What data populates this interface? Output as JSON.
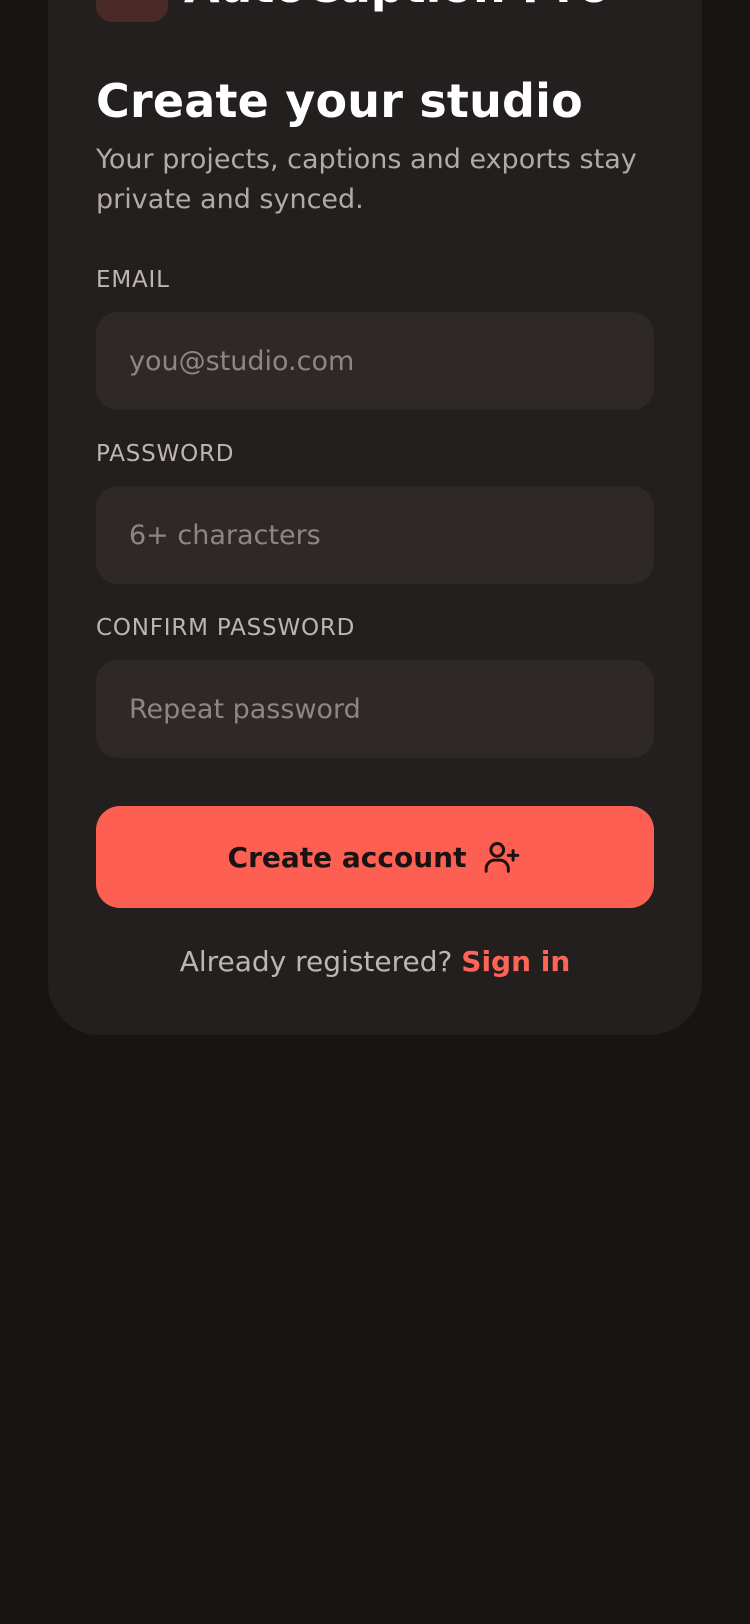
{
  "brand": {
    "name": "AutoCaption Pro"
  },
  "heading": {
    "title": "Create your studio",
    "subtitle": "Your projects, captions and exports stay private and synced."
  },
  "form": {
    "email": {
      "label": "EMAIL",
      "placeholder": "you@studio.com",
      "value": ""
    },
    "password": {
      "label": "PASSWORD",
      "placeholder": "6+ characters",
      "value": ""
    },
    "confirm_password": {
      "label": "CONFIRM PASSWORD",
      "placeholder": "Repeat password",
      "value": ""
    },
    "submit": {
      "label": "Create account",
      "icon": "user-plus-icon"
    }
  },
  "footer": {
    "prompt": "Already registered?",
    "link_label": "Sign in"
  },
  "colors": {
    "background": "#181414",
    "card": "#231f1f",
    "input": "#2e2927",
    "accent": "#fd6053"
  }
}
